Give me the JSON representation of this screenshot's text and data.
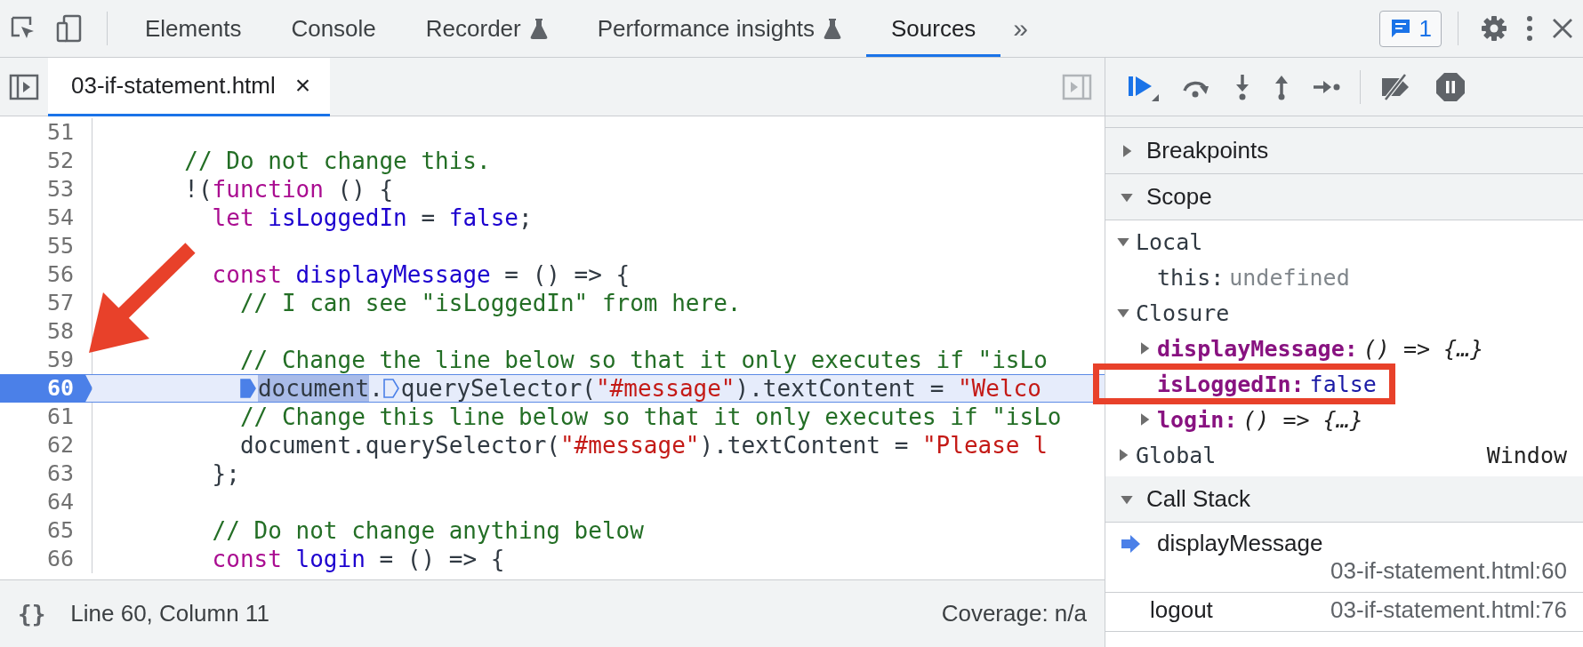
{
  "toolbar": {
    "tabs": [
      {
        "label": "Elements",
        "selected": false,
        "experimental": false
      },
      {
        "label": "Console",
        "selected": false,
        "experimental": false
      },
      {
        "label": "Recorder",
        "selected": false,
        "experimental": true
      },
      {
        "label": "Performance insights",
        "selected": false,
        "experimental": true
      },
      {
        "label": "Sources",
        "selected": true,
        "experimental": false
      }
    ],
    "more": "»",
    "issues_count": "1"
  },
  "editor": {
    "file_tab": {
      "label": "03-if-statement.html",
      "close": "×",
      "selected": true
    },
    "lines": [
      {
        "number": "51",
        "paused": false
      },
      {
        "number": "52",
        "paused": false,
        "tokens": [
          {
            "kind": "comment",
            "text": "      // Do not change this."
          }
        ]
      },
      {
        "number": "53",
        "paused": false,
        "tokens": [
          {
            "kind": "plain",
            "text": "      !("
          },
          {
            "kind": "keyword",
            "text": "function"
          },
          {
            "kind": "plain",
            "text": " () {"
          }
        ]
      },
      {
        "number": "54",
        "paused": false,
        "tokens": [
          {
            "kind": "keyword",
            "text": "        let"
          },
          {
            "kind": "def",
            "text": " isLoggedIn"
          },
          {
            "kind": "plain",
            "text": " = "
          },
          {
            "kind": "def",
            "text": "false"
          },
          {
            "kind": "plain",
            "text": ";"
          }
        ]
      },
      {
        "number": "55",
        "paused": false
      },
      {
        "number": "56",
        "paused": false,
        "tokens": [
          {
            "kind": "keyword",
            "text": "        const"
          },
          {
            "kind": "def",
            "text": " displayMessage"
          },
          {
            "kind": "plain",
            "text": " = () => {"
          }
        ]
      },
      {
        "number": "57",
        "paused": false,
        "tokens": [
          {
            "kind": "comment",
            "text": "          // I can see \"isLoggedIn\" from here."
          }
        ]
      },
      {
        "number": "58",
        "paused": false
      },
      {
        "number": "59",
        "paused": false,
        "tokens": [
          {
            "kind": "comment",
            "text": "          // Change the line below so that it only executes if \"isLo"
          }
        ]
      },
      {
        "number": "60",
        "paused": true,
        "tokens": [
          {
            "kind": "breakpoint",
            "active": true
          },
          {
            "kind": "selected",
            "text": "          document"
          },
          {
            "kind": "plain",
            "text": "."
          },
          {
            "kind": "breakpoint",
            "active": false
          },
          {
            "kind": "plain",
            "text": "querySelector("
          },
          {
            "kind": "string",
            "text": "\"#message\""
          },
          {
            "kind": "plain",
            "text": ").textContent = "
          },
          {
            "kind": "string",
            "text": "\"Welco"
          }
        ]
      },
      {
        "number": "61",
        "paused": false,
        "tokens": [
          {
            "kind": "comment",
            "text": "          // Change this line below so that it only executes if \"isLo"
          }
        ]
      },
      {
        "number": "62",
        "paused": false,
        "tokens": [
          {
            "kind": "plain",
            "text": "          document.querySelector("
          },
          {
            "kind": "string",
            "text": "\"#message\""
          },
          {
            "kind": "plain",
            "text": ").textContent = "
          },
          {
            "kind": "string",
            "text": "\"Please l"
          }
        ]
      },
      {
        "number": "63",
        "paused": false,
        "tokens": [
          {
            "kind": "plain",
            "text": "        };"
          }
        ]
      },
      {
        "number": "64",
        "paused": false
      },
      {
        "number": "65",
        "paused": false,
        "tokens": [
          {
            "kind": "comment",
            "text": "        // Do not change anything below"
          }
        ]
      },
      {
        "number": "66",
        "paused": false,
        "tokens": [
          {
            "kind": "keyword",
            "text": "        const"
          },
          {
            "kind": "def",
            "text": " login"
          },
          {
            "kind": "plain",
            "text": " = () => {"
          }
        ]
      }
    ]
  },
  "status_bar": {
    "format": "{}",
    "position": "Line 60, Column 11",
    "coverage": "Coverage: n/a"
  },
  "debugger": {
    "sections": [
      {
        "kind": "breakpoints",
        "title": "Breakpoints",
        "expanded": false
      },
      {
        "kind": "scope",
        "title": "Scope",
        "expanded": true,
        "tree": [
          {
            "label": "Local",
            "expanded": true,
            "children": [
              {
                "name": "this:",
                "value": "undefined",
                "kind": "undefined"
              }
            ]
          },
          {
            "label": "Closure",
            "expanded": true,
            "children": [
              {
                "name": "displayMessage:",
                "value": "() => {…}",
                "kind": "function",
                "expanded": false
              },
              {
                "name": "isLoggedIn:",
                "value": "false",
                "kind": "boolean",
                "highlighted": true
              },
              {
                "name": "login:",
                "value": "() => {…}",
                "kind": "function",
                "expanded": false
              }
            ]
          },
          {
            "label": "Global",
            "expanded": false,
            "value": "Window"
          }
        ]
      },
      {
        "kind": "callstack",
        "title": "Call Stack",
        "expanded": true,
        "frames": [
          {
            "function": "displayMessage",
            "location": "03-if-statement.html:60",
            "selected": true
          },
          {
            "function": "logout",
            "location": "03-if-statement.html:76",
            "selected": false
          }
        ]
      }
    ]
  }
}
